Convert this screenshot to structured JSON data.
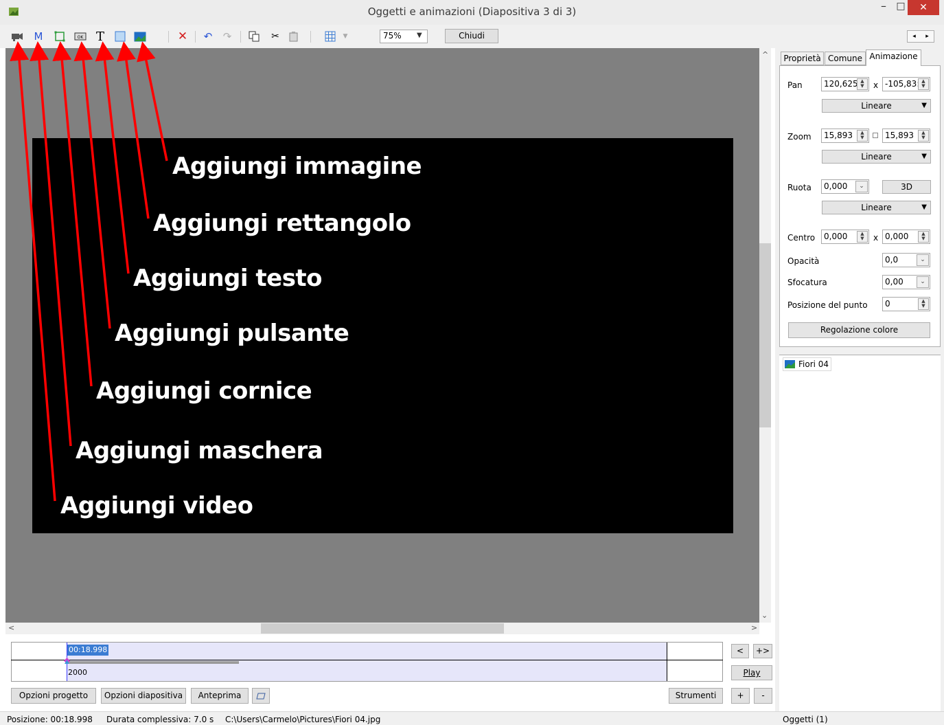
{
  "window": {
    "title": "Oggetti e animazioni  (Diapositiva 3 di 3)",
    "minimize_glyph": "–",
    "maximize_glyph": "□",
    "close_glyph": "✕"
  },
  "toolbar": {
    "mask_letter": "M",
    "text_letter": "T",
    "zoom_value": "75%",
    "close_label": "Chiudi",
    "icons": [
      "video-icon",
      "mask-icon",
      "frame-icon",
      "button-icon",
      "text-icon",
      "rectangle-icon",
      "image-icon",
      "delete-icon",
      "undo-icon",
      "redo-icon",
      "copy-icon",
      "cut-icon",
      "paste-icon",
      "grid-icon"
    ]
  },
  "annotations": {
    "image": "Aggiungi immagine",
    "rectangle": "Aggiungi rettangolo",
    "text": "Aggiungi testo",
    "button": "Aggiungi pulsante",
    "frame": "Aggiungi cornice",
    "mask": "Aggiungi maschera",
    "video": "Aggiungi video"
  },
  "timeline": {
    "current_time": "00:18.998",
    "value": "2000",
    "prev_label": "<",
    "next_label": "+>",
    "play_label": "Play",
    "plus_label": "+",
    "minus_label": "-"
  },
  "bottom_buttons": {
    "project_options": "Opzioni progetto",
    "slide_options": "Opzioni diapositiva",
    "preview": "Anteprima",
    "tools": "Strumenti"
  },
  "tabs": [
    "Proprietà",
    "Comune",
    "Animazione"
  ],
  "animation": {
    "pan_label": "Pan",
    "pan_x": "120,625",
    "pan_y": "-105,83:",
    "pan_x_sep": "x",
    "pan_interp": "Lineare",
    "zoom_label": "Zoom",
    "zoom_x": "15,893",
    "zoom_y": "15,893",
    "zoom_interp": "Lineare",
    "rotate_label": "Ruota",
    "rotate_value": "0,000",
    "button_3d": "3D",
    "rotate_interp": "Lineare",
    "center_label": "Centro",
    "center_x": "0,000",
    "center_y": "0,000",
    "center_sep": "x",
    "opacity_label": "Opacità",
    "opacity_value": "0,0",
    "blur_label": "Sfocatura",
    "blur_value": "0,00",
    "point_pos_label": "Posizione del punto",
    "point_pos_value": "0",
    "color_adjust_label": "Regolazione colore"
  },
  "objects": {
    "item": "Fiori 04"
  },
  "status": {
    "position": "Posizione:  00:18.998",
    "total_duration": "Durata complessiva:  7.0 s",
    "path": "C:\\Users\\Carmelo\\Pictures\\Fiori 04.jpg",
    "objects_count": "Oggetti (1)"
  },
  "colors": {
    "canvas_bg": "#808080",
    "slide_bg": "#000000",
    "arrow": "#ff0000",
    "close_red": "#c7372f",
    "timeline_band": "#e6e6fa",
    "selection_blue": "#3b7cd3"
  }
}
